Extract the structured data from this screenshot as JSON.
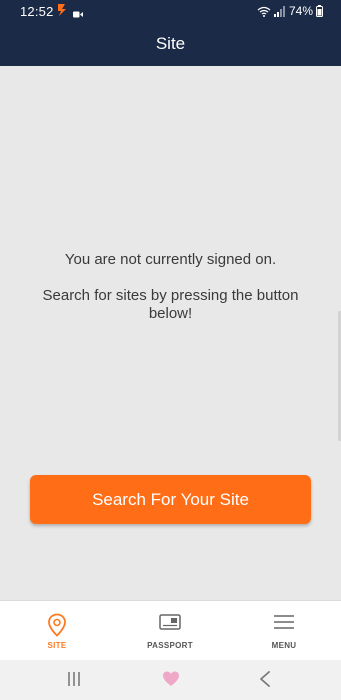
{
  "status_bar": {
    "time": "12:52",
    "battery": "74%",
    "app_icon": "app-logo-icon",
    "video_icon": "video-camera-icon",
    "wifi_icon": "wifi-icon",
    "signal_icon": "signal-icon",
    "battery_icon": "battery-icon"
  },
  "header": {
    "title": "Site",
    "background_color": "#1b2a47"
  },
  "main": {
    "message_primary": "You are not currently signed on.",
    "message_secondary": "Search for sites by pressing the button below!",
    "search_button_label": "Search For Your Site",
    "accent_color": "#ff6e16"
  },
  "bottom_nav": {
    "items": [
      {
        "label": "SITE",
        "icon": "location-pin-icon",
        "active": true
      },
      {
        "label": "PASSPORT",
        "icon": "passport-card-icon",
        "active": false
      },
      {
        "label": "MENU",
        "icon": "hamburger-menu-icon",
        "active": false
      }
    ]
  },
  "system_nav": {
    "recents_icon": "recents-icon",
    "home_icon": "home-heart-icon",
    "back_icon": "back-chevron-icon"
  }
}
